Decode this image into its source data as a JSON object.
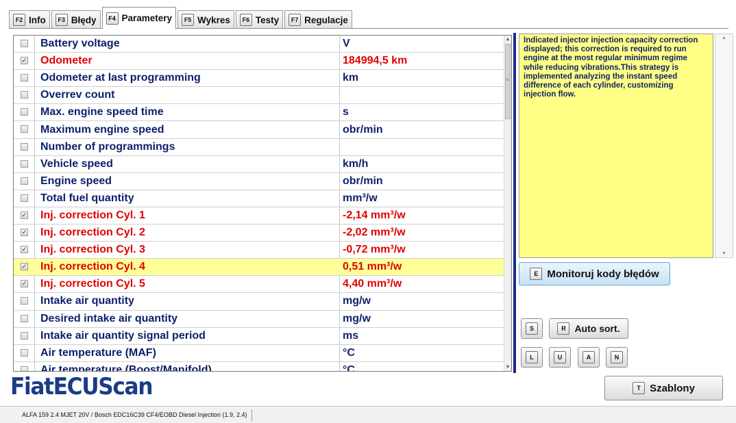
{
  "tabs": [
    {
      "key": "F2",
      "label": "Info",
      "active": false
    },
    {
      "key": "F3",
      "label": "Błędy",
      "active": false
    },
    {
      "key": "F4",
      "label": "Parametery",
      "active": true
    },
    {
      "key": "F5",
      "label": "Wykres",
      "active": false
    },
    {
      "key": "F6",
      "label": "Testy",
      "active": false
    },
    {
      "key": "F7",
      "label": "Regulacje",
      "active": false
    }
  ],
  "parameters": [
    {
      "name": "Battery voltage",
      "value": "V",
      "checked": false,
      "highlight": false,
      "selected": false
    },
    {
      "name": "Odometer",
      "value": "184994,5 km",
      "checked": true,
      "highlight": true,
      "selected": false
    },
    {
      "name": "Odometer at last programming",
      "value": "km",
      "checked": false,
      "highlight": false,
      "selected": false
    },
    {
      "name": "Overrev count",
      "value": "",
      "checked": false,
      "highlight": false,
      "selected": false
    },
    {
      "name": "Max. engine speed time",
      "value": "s",
      "checked": false,
      "highlight": false,
      "selected": false
    },
    {
      "name": "Maximum engine speed",
      "value": "obr/min",
      "checked": false,
      "highlight": false,
      "selected": false
    },
    {
      "name": "Number of programmings",
      "value": "",
      "checked": false,
      "highlight": false,
      "selected": false
    },
    {
      "name": "Vehicle speed",
      "value": "km/h",
      "checked": false,
      "highlight": false,
      "selected": false
    },
    {
      "name": "Engine speed",
      "value": "obr/min",
      "checked": false,
      "highlight": false,
      "selected": false
    },
    {
      "name": "Total fuel quantity",
      "value": "mm³/w",
      "checked": false,
      "highlight": false,
      "selected": false
    },
    {
      "name": "Inj. correction Cyl. 1",
      "value": "-2,14 mm³/w",
      "checked": true,
      "highlight": true,
      "selected": false
    },
    {
      "name": "Inj. correction Cyl. 2",
      "value": "-2,02 mm³/w",
      "checked": true,
      "highlight": true,
      "selected": false
    },
    {
      "name": "Inj. correction Cyl. 3",
      "value": "-0,72 mm³/w",
      "checked": true,
      "highlight": true,
      "selected": false
    },
    {
      "name": "Inj. correction Cyl. 4",
      "value": "0,51 mm³/w",
      "checked": true,
      "highlight": true,
      "selected": true
    },
    {
      "name": "Inj. correction Cyl. 5",
      "value": "4,40 mm³/w",
      "checked": true,
      "highlight": true,
      "selected": false
    },
    {
      "name": "Intake air quantity",
      "value": "mg/w",
      "checked": false,
      "highlight": false,
      "selected": false
    },
    {
      "name": "Desired intake air quantity",
      "value": "mg/w",
      "checked": false,
      "highlight": false,
      "selected": false
    },
    {
      "name": "Intake air quantity signal period",
      "value": "ms",
      "checked": false,
      "highlight": false,
      "selected": false
    },
    {
      "name": "Air temperature (MAF)",
      "value": "°C",
      "checked": false,
      "highlight": false,
      "selected": false
    },
    {
      "name": "Air temperature (Boost/Manifold)",
      "value": "°C",
      "checked": false,
      "highlight": false,
      "selected": false
    }
  ],
  "description": "Indicated injector injection capacity correction displayed; this correction is required to run engine at the most regular minimum regime while reducing vibrations.This strategy is implemented analyzing the instant speed difference of each cylinder, customizing injection flow.",
  "buttons": {
    "monitor": {
      "key": "E",
      "label": "Monitoruj kody błędów"
    },
    "s": {
      "key": "S"
    },
    "autosort": {
      "key": "R",
      "label": "Auto sort."
    },
    "l": {
      "key": "L"
    },
    "u": {
      "key": "U"
    },
    "a": {
      "key": "A"
    },
    "n": {
      "key": "N"
    },
    "szablony": {
      "key": "T",
      "label": "Szablony"
    }
  },
  "logo": "FiatECUScan",
  "status": "ALFA 159 2.4 MJET 20V / Bosch EDC16C39 CF4/EOBD Diesel Injection (1.9, 2.4)",
  "colors": {
    "highlight": "#e00000",
    "normal": "#0d1f6b",
    "selected_row": "#ffff99",
    "description_bg": "#ffff85"
  }
}
